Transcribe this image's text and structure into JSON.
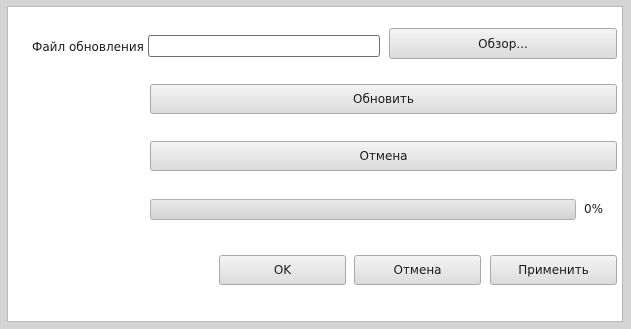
{
  "form": {
    "file_label": "Файл обновления",
    "file_value": "",
    "browse_label": "Обзор...",
    "update_label": "Обновить",
    "cancel_label": "Отмена",
    "progress_value": 0,
    "progress_text": "0%"
  },
  "dialog_buttons": {
    "ok_label": "OK",
    "cancel_label": "Отмена",
    "apply_label": "Применить"
  },
  "colors": {
    "window_bg": "#d4d4d4",
    "panel_bg": "#ffffff",
    "button_gradient_top": "#f4f4f4",
    "button_gradient_bottom": "#dcdcdc"
  }
}
